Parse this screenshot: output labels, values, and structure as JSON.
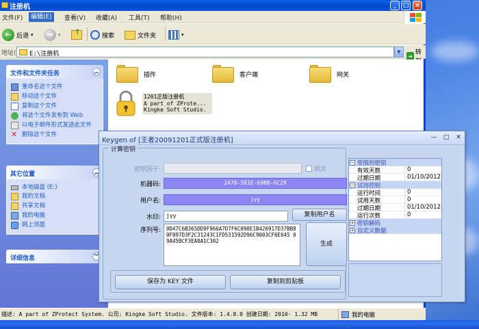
{
  "explorer": {
    "title": "注册机",
    "menu": [
      "文件(F)",
      "编辑(E)",
      "查看(V)",
      "收藏(A)",
      "工具(T)",
      "帮助(H)"
    ],
    "menu_active_index": 1,
    "toolbar": {
      "back": "后退",
      "search": "搜索",
      "folders": "文件夹"
    },
    "address_label": "地址(D)",
    "address_value": "E:\\注册机",
    "go_label": "转到",
    "left_pane": {
      "tasks_title": "文件和文件夹任务",
      "tasks": [
        "重命名这个文件",
        "移动这个文件",
        "复制这个文件",
        "将这个文件发布到 Web",
        "以电子邮件形式发送此文件",
        "删除这个文件"
      ],
      "places_title": "其它位置",
      "places": [
        "本地磁盘 (E:)",
        "我的文档",
        "共享文档",
        "我的电脑",
        "网上邻居"
      ],
      "details_title": "详细信息"
    },
    "folders": [
      "插件",
      "客户端",
      "网关"
    ],
    "file": {
      "line1": "1201正版注册机",
      "line2": "A part of ZProte...",
      "line3": "Kingke Soft Studio."
    },
    "status_text": "描述: A part of ZProtect System. 公司: Kingke Soft Studio. 文件版本: 1.4.8.0 创建日期: 2010- 1.32 MB",
    "status_right": "我的电脑"
  },
  "keygen": {
    "title": "Keygen of [王者20091201正式版注册机]",
    "group_label": "计算密钥",
    "key_factor_label": "密钥因子:",
    "plaintext_label": "明文",
    "machine_code_label": "机器码:",
    "machine_code": "2478-581E-69B8-6C29",
    "username_label": "用户名:",
    "username": "jyy",
    "watermark_label": "水印:",
    "watermark": "jyy",
    "copy_username_button": "复制用户名",
    "serial_label": "序列号:",
    "serial": "0D47C6B365DD9F966A7D7F6C098E1B426917D37BB80F097D3F2C31243C1FD531592D96C9003CF6E645 09A45BCF3EA0A1C302",
    "generate_button": "生成",
    "save_key_button": "保存为 KEY 文件",
    "copy_clipboard_button": "复制到剪贴板",
    "properties": [
      {
        "category": "受限的密钥",
        "rows": [
          {
            "k": "有效天数",
            "v": "0"
          },
          {
            "k": "过期日期",
            "v": "01/10/2012"
          }
        ]
      },
      {
        "category": "试用控制",
        "rows": [
          {
            "k": "运行时间",
            "v": "0"
          },
          {
            "k": "试用天数",
            "v": "0"
          },
          {
            "k": "过期日期",
            "v": "01/10/2012"
          },
          {
            "k": "运行次数",
            "v": "0"
          }
        ]
      },
      {
        "category": "密钥解码",
        "rows": []
      },
      {
        "category": "自定义数据",
        "rows": []
      }
    ]
  },
  "colors": {
    "xp_blue": "#0a54e0",
    "task_link": "#215dc6",
    "purple_field": "#8c86f4",
    "dialog_bg": "#c7d7f0"
  }
}
